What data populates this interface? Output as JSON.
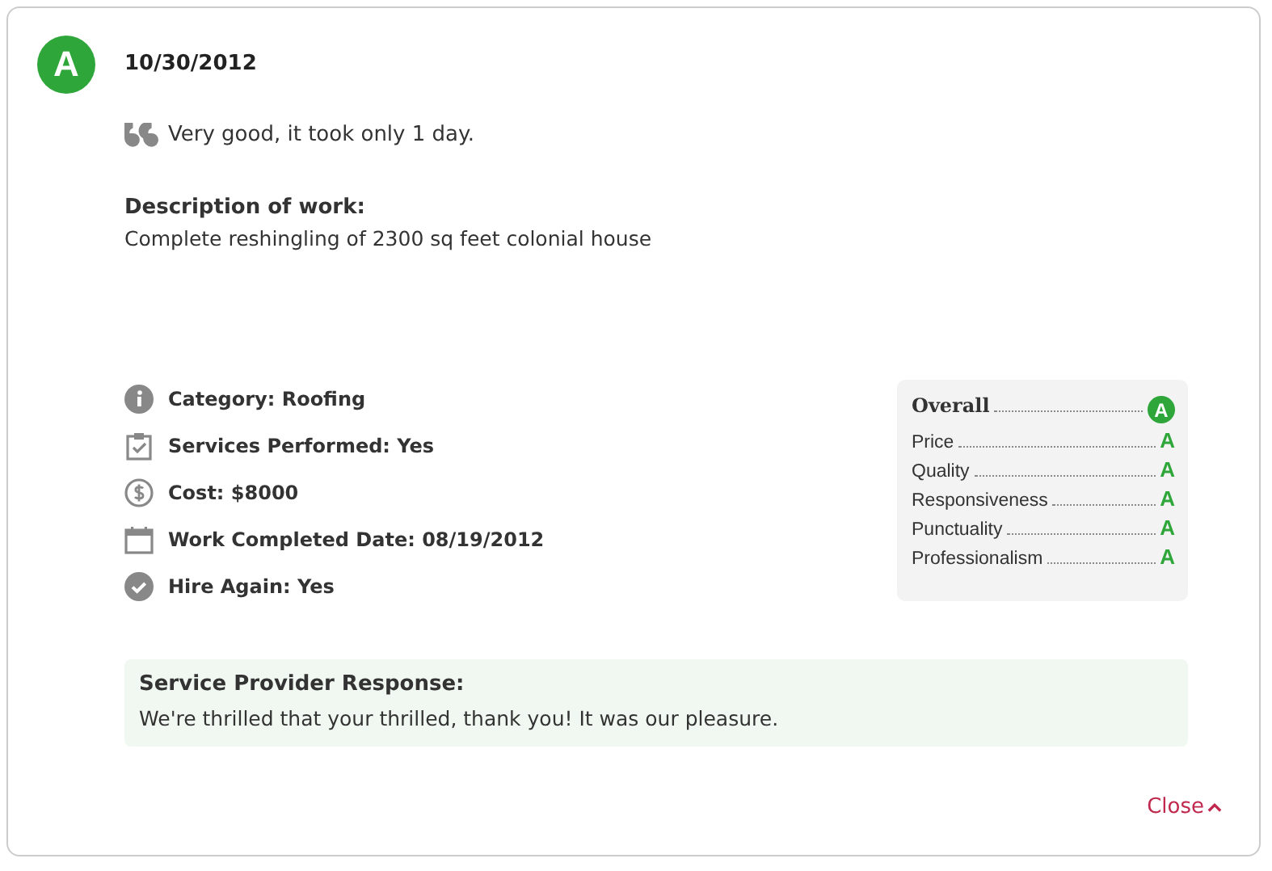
{
  "review": {
    "grade": "A",
    "date": "10/30/2012",
    "quote": "Very good, it took only 1 day.",
    "description_label": "Description of work:",
    "description": "Complete reshingling of 2300 sq feet colonial house"
  },
  "details": [
    {
      "kind": "info",
      "text": "Category: Roofing"
    },
    {
      "kind": "clipboard",
      "text": "Services Performed: Yes"
    },
    {
      "kind": "dollar",
      "text": "Cost: $8000"
    },
    {
      "kind": "calendar",
      "text": "Work Completed Date: 08/19/2012"
    },
    {
      "kind": "check",
      "text": "Hire Again: Yes"
    }
  ],
  "ratings": [
    {
      "kind": "overall",
      "label": "Overall",
      "grade": "A"
    },
    {
      "kind": "item",
      "label": "Price",
      "grade": "A"
    },
    {
      "kind": "item",
      "label": "Quality",
      "grade": "A"
    },
    {
      "kind": "item",
      "label": "Responsiveness",
      "grade": "A"
    },
    {
      "kind": "item",
      "label": "Punctuality",
      "grade": "A"
    },
    {
      "kind": "item",
      "label": "Professionalism",
      "grade": "A"
    }
  ],
  "response": {
    "title": "Service Provider Response:",
    "text": "We're thrilled that your thrilled, thank you! It was our pleasure."
  },
  "close": {
    "label": "Close"
  }
}
